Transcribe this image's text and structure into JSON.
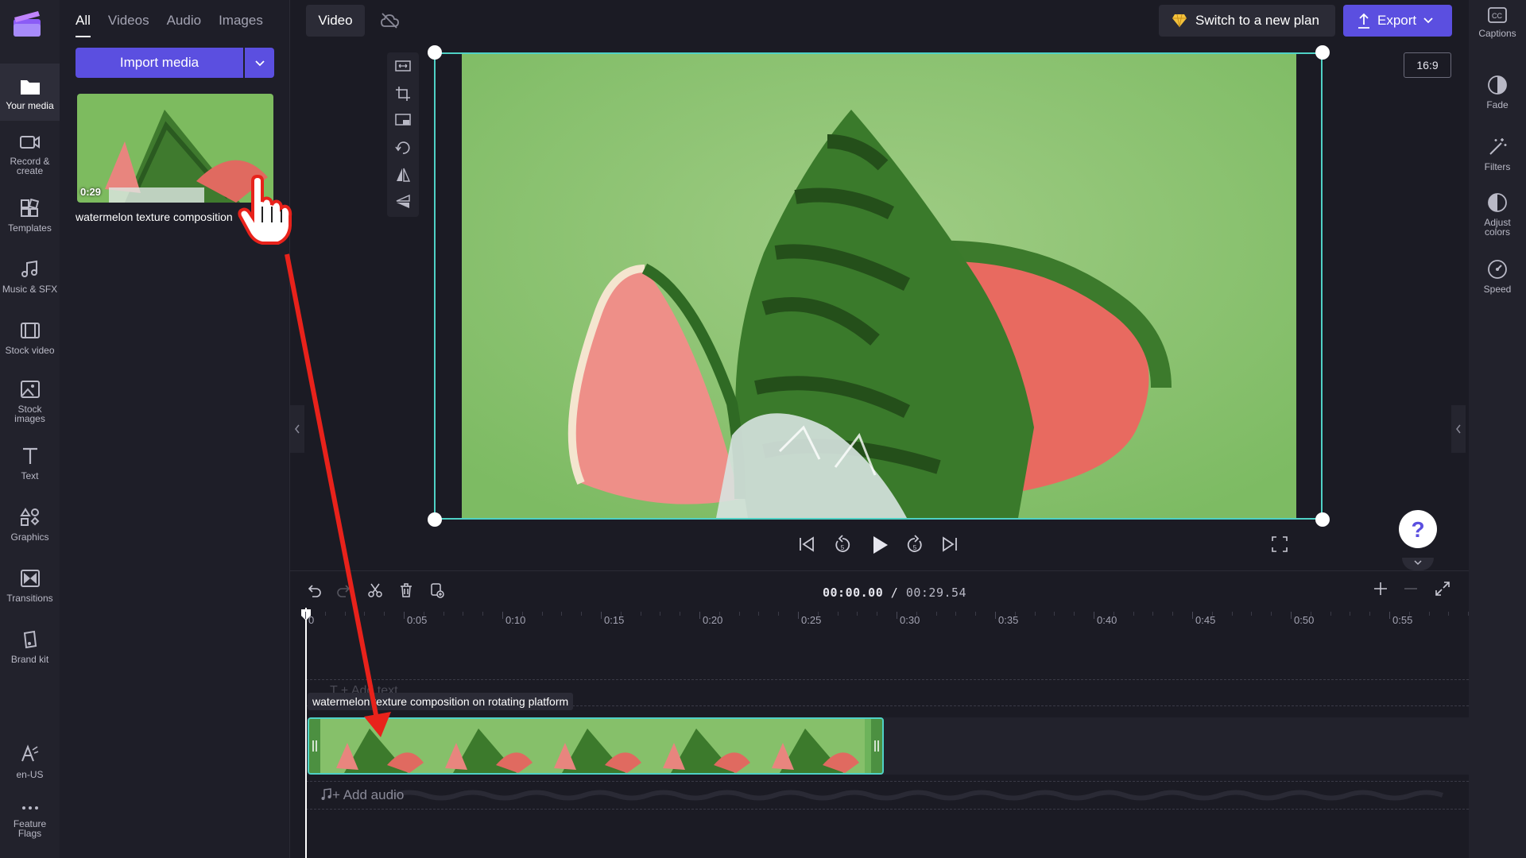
{
  "left_rail": {
    "items": [
      {
        "label": "Your media",
        "icon": "folder-icon"
      },
      {
        "label": "Record &\ncreate",
        "icon": "camera-icon"
      },
      {
        "label": "Templates",
        "icon": "templates-icon"
      },
      {
        "label": "Music & SFX",
        "icon": "music-icon"
      },
      {
        "label": "Stock video",
        "icon": "film-icon"
      },
      {
        "label": "Stock\nimages",
        "icon": "image-icon"
      },
      {
        "label": "Text",
        "icon": "text-icon"
      },
      {
        "label": "Graphics",
        "icon": "shapes-icon"
      },
      {
        "label": "Transitions",
        "icon": "transitions-icon"
      },
      {
        "label": "Brand kit",
        "icon": "brand-kit-icon"
      },
      {
        "label": "en-US",
        "icon": "language-icon"
      },
      {
        "label": "Feature\nFlags",
        "icon": "more-icon"
      }
    ]
  },
  "media_panel": {
    "tabs": [
      "All",
      "Videos",
      "Audio",
      "Images"
    ],
    "active_tab": "All",
    "import_label": "Import media",
    "item": {
      "duration": "0:29",
      "title": "watermelon texture composition"
    }
  },
  "toolbar": {
    "video_label": "Video",
    "plan_label": "Switch to a new plan",
    "export_label": "Export"
  },
  "right_rail": {
    "items": [
      {
        "label": "Captions",
        "icon": "captions-icon"
      },
      {
        "label": "Fade",
        "icon": "fade-icon"
      },
      {
        "label": "Filters",
        "icon": "filters-icon"
      },
      {
        "label": "Adjust\ncolors",
        "icon": "adjust-colors-icon"
      },
      {
        "label": "Speed",
        "icon": "speed-icon"
      }
    ]
  },
  "preview": {
    "aspect_ratio": "16:9",
    "help": "?"
  },
  "timeline": {
    "current_time": "00:00.00",
    "separator": " / ",
    "total_time": "00:29.54",
    "ruler_labels": [
      "0",
      "0:05",
      "0:10",
      "0:15",
      "0:20",
      "0:25",
      "0:30",
      "0:35",
      "0:40",
      "0:45",
      "0:50",
      "0:55"
    ],
    "text_lane_placeholder": "T  + Add text",
    "clip_title": "watermelon texture composition on rotating platform",
    "audio_lane_label": "+ Add audio"
  },
  "colors": {
    "accent": "#5b4fe0",
    "selection": "#4fd1c5",
    "annotation": "#e8221b",
    "background": "#1b1b24"
  }
}
